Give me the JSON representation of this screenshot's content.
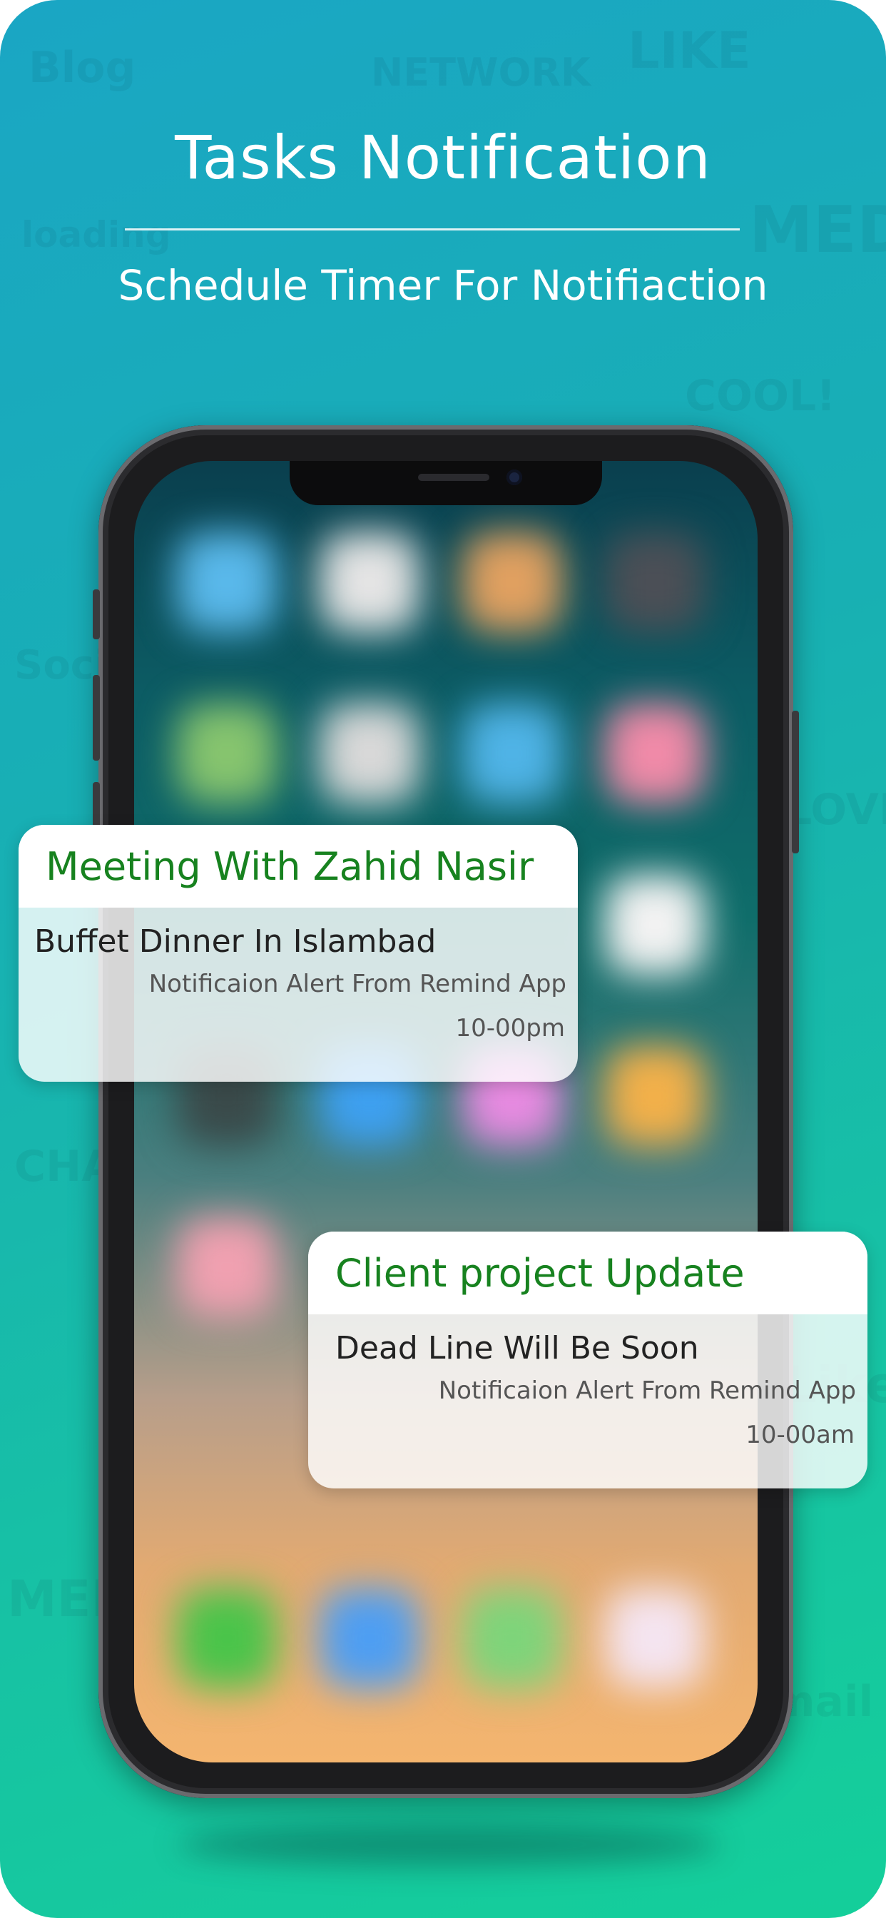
{
  "header": {
    "title": "Tasks  Notification",
    "subtitle": "Schedule Timer For Notifiaction"
  },
  "notifications": [
    {
      "title": "Meeting With Zahid Nasir",
      "message": "Buffet Dinner In Islambad",
      "source": "Notificaion Alert From Remind App",
      "time": "10-00pm"
    },
    {
      "title": "Client project Update",
      "message": "Dead Line Will Be Soon",
      "source": "Notificaion Alert From Remind App",
      "time": "10-00am"
    }
  ],
  "colors": {
    "background_top": "#1aa6c4",
    "background_bottom": "#14cf9a",
    "notification_title": "#17821f"
  }
}
